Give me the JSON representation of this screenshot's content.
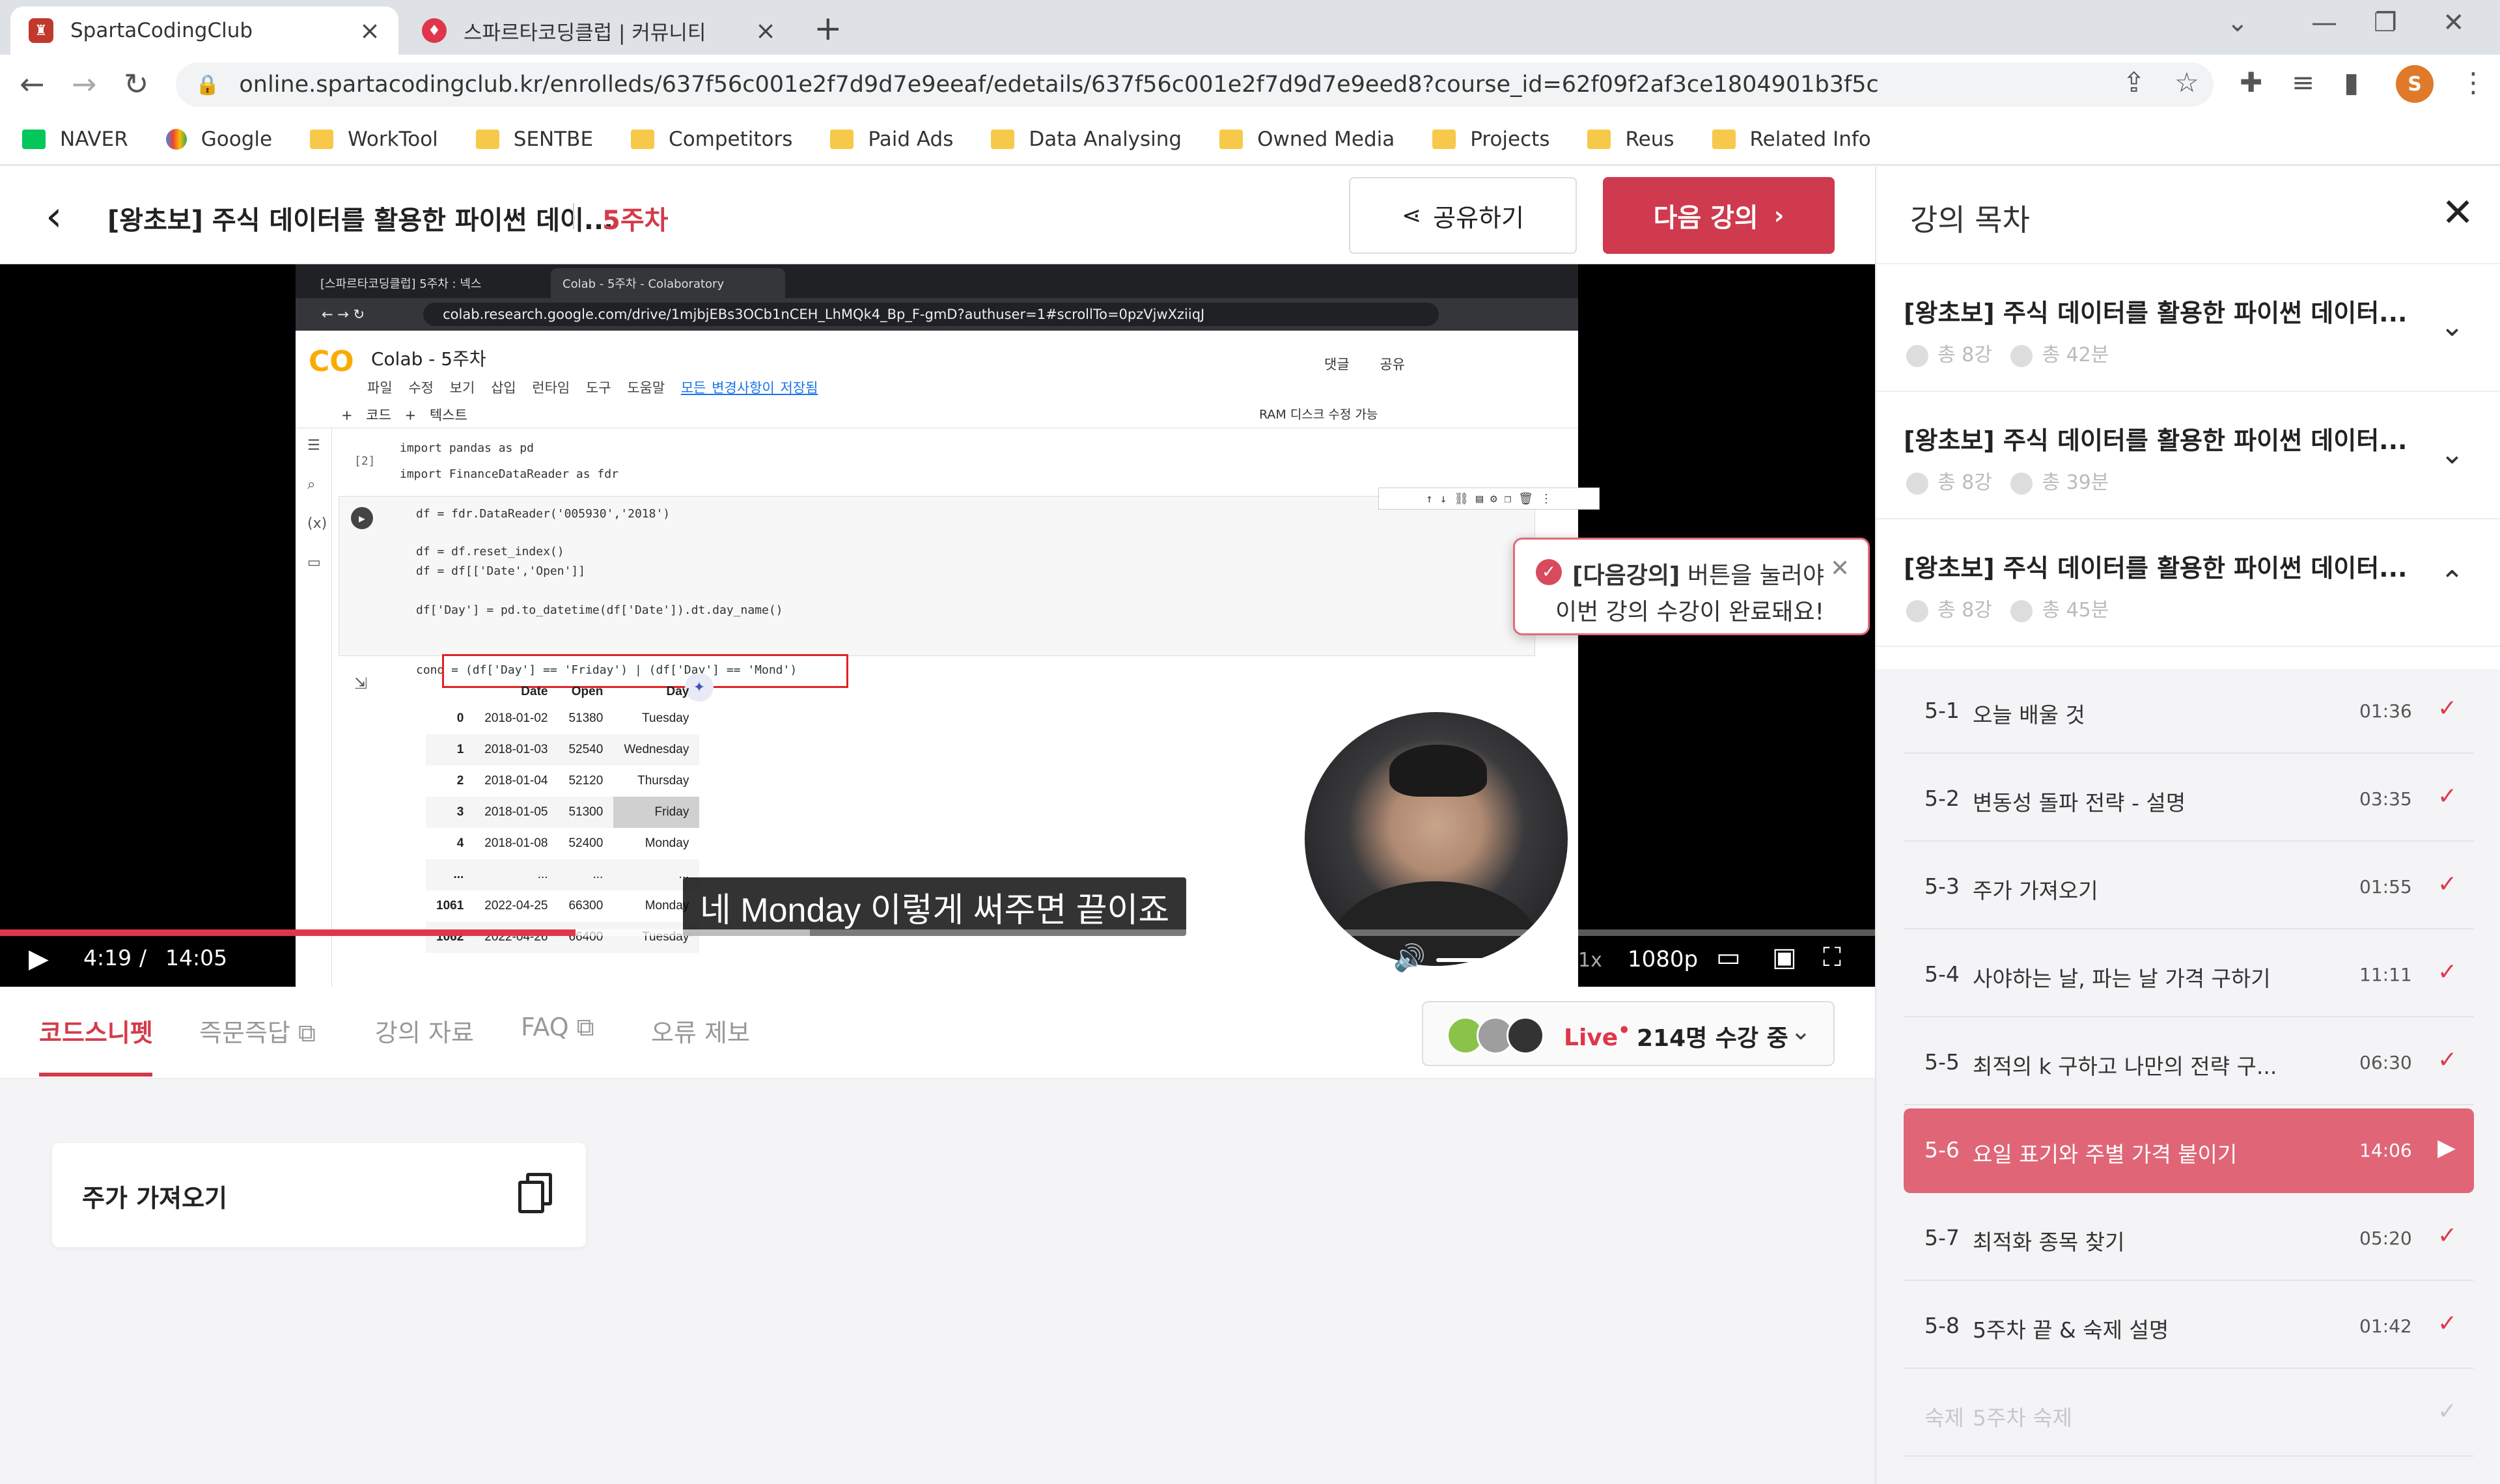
{
  "browser": {
    "tabs": [
      {
        "title": "SpartaCodingClub",
        "active": true
      },
      {
        "title": "스파르타코딩클럽 | 커뮤니티",
        "active": false
      }
    ],
    "url": "online.spartacodingclub.kr/enrolleds/637f56c001e2f7d9d7e9eeaf/edetails/637f56c001e2f7d9d7e9eed8?course_id=62f09f2af3ce1804901b3f5c",
    "profile_initial": "S",
    "bookmarks": [
      "NAVER",
      "Google",
      "WorkTool",
      "SENTBE",
      "Competitors",
      "Paid Ads",
      "Data Analysing",
      "Owned Media",
      "Projects",
      "Reus",
      "Related Info"
    ]
  },
  "header": {
    "course_title": "[왕초보] 주식 데이터를 활용한 파이썬 데이...",
    "week": "5주차",
    "share_label": "공유하기",
    "next_label": "다음 강의"
  },
  "video": {
    "inner_tabs": [
      "[스파르타코딩클럽] 5주차 : 넥스",
      "Colab - 5주차 - Colaboratory"
    ],
    "inner_url": "colab.research.google.com/drive/1mjbjEBs3OCb1nCEH_LhMQk4_Bp_F-gmD?authuser=1#scrollTo=0pzVjwXziiqJ",
    "colab": {
      "title": "Colab - 5주차",
      "menu": "파일 수정 보기 삽입 런타임 도구 도움말",
      "saved": "모든 변경사항이 저장됨",
      "tools": "댓글 공유",
      "toolbar": "+ 코드  + 텍스트",
      "right_tools": "RAM 디스크   수정 가능",
      "cell1_label": "[2]",
      "cell1_lines": [
        "import pandas as pd",
        "import FinanceDataReader as fdr"
      ],
      "cell2_lines": [
        "df = fdr.DataReader('005930','2018')",
        "",
        "df = df.reset_index()",
        "df = df[['Date','Open']]",
        "",
        "df['Day'] = pd.to_datetime(df['Date']).dt.day_name()",
        "",
        "cond = (df['Day'] == 'Friday') | (df['Day'] == 'Mond')"
      ],
      "table_headers": [
        "",
        "Date",
        "Open",
        "Day"
      ],
      "table_rows": [
        [
          "0",
          "2018-01-02",
          "51380",
          "Tuesday"
        ],
        [
          "1",
          "2018-01-03",
          "52540",
          "Wednesday"
        ],
        [
          "2",
          "2018-01-04",
          "52120",
          "Thursday"
        ],
        [
          "3",
          "2018-01-05",
          "51300",
          "Friday"
        ],
        [
          "4",
          "2018-01-08",
          "52400",
          "Monday"
        ],
        [
          "...",
          "...",
          "...",
          "..."
        ],
        [
          "1061",
          "2022-04-25",
          "66300",
          "Monday"
        ],
        [
          "1062",
          "2022-04-26",
          "66400",
          "Tuesday"
        ]
      ]
    },
    "subtitle": "네 Monday 이렇게 써주면 끝이죠",
    "toast": {
      "bold": "[다음강의]",
      "line1_rest": " 버튼을 눌러야",
      "line2": "이번 강의 수강이 완료돼요!"
    },
    "time_current": "4:19",
    "time_sep": "/",
    "time_total": "14:05",
    "progress_fraction": 0.307,
    "buffer_fraction": 0.125,
    "speed": "1x",
    "quality": "1080p"
  },
  "sub_tabs": [
    {
      "label": "코드스니펫",
      "active": true
    },
    {
      "label": "즉문즉답 ⧉",
      "active": false
    },
    {
      "label": "강의 자료",
      "active": false
    },
    {
      "label": "FAQ ⧉",
      "active": false
    },
    {
      "label": "오류 제보",
      "active": false
    }
  ],
  "live": {
    "label": "Live",
    "dot": "•",
    "count": "214명 수강 중"
  },
  "snippet": {
    "label": "주가 가져오기"
  },
  "curriculum": {
    "title": "강의 목차",
    "weeks": [
      {
        "title": "[왕초보] 주식 데이터를 활용한 파이썬 데이터...",
        "count": "총 8강",
        "duration": "총 42분",
        "expanded": false
      },
      {
        "title": "[왕초보] 주식 데이터를 활용한 파이썬 데이터...",
        "count": "총 8강",
        "duration": "총 39분",
        "expanded": false
      },
      {
        "title": "[왕초보] 주식 데이터를 활용한 파이썬 데이터...",
        "count": "총 8강",
        "duration": "총 45분",
        "expanded": true
      }
    ],
    "lessons": [
      {
        "num": "5-1",
        "title": "오늘 배울 것",
        "duration": "01:36",
        "state": "done"
      },
      {
        "num": "5-2",
        "title": "변동성 돌파 전략 - 설명",
        "duration": "03:35",
        "state": "done"
      },
      {
        "num": "5-3",
        "title": "주가 가져오기",
        "duration": "01:55",
        "state": "done"
      },
      {
        "num": "5-4",
        "title": "사야하는 날, 파는 날 가격 구하기",
        "duration": "11:11",
        "state": "done"
      },
      {
        "num": "5-5",
        "title": "최적의 k 구하고 나만의 전략 구...",
        "duration": "06:30",
        "state": "done"
      },
      {
        "num": "5-6",
        "title": "요일 표기와 주별 가격 붙이기",
        "duration": "14:06",
        "state": "playing"
      },
      {
        "num": "5-7",
        "title": "최적화 종목 찾기",
        "duration": "05:20",
        "state": "done"
      },
      {
        "num": "5-8",
        "title": "5주차 끝 & 숙제 설명",
        "duration": "01:42",
        "state": "done"
      },
      {
        "num": "숙제",
        "title": "5주차 숙제",
        "duration": "",
        "state": "locked"
      }
    ]
  },
  "colors": {
    "accent": "#cf3a4e",
    "accent_light": "#e06677",
    "check": "#e0364c"
  }
}
